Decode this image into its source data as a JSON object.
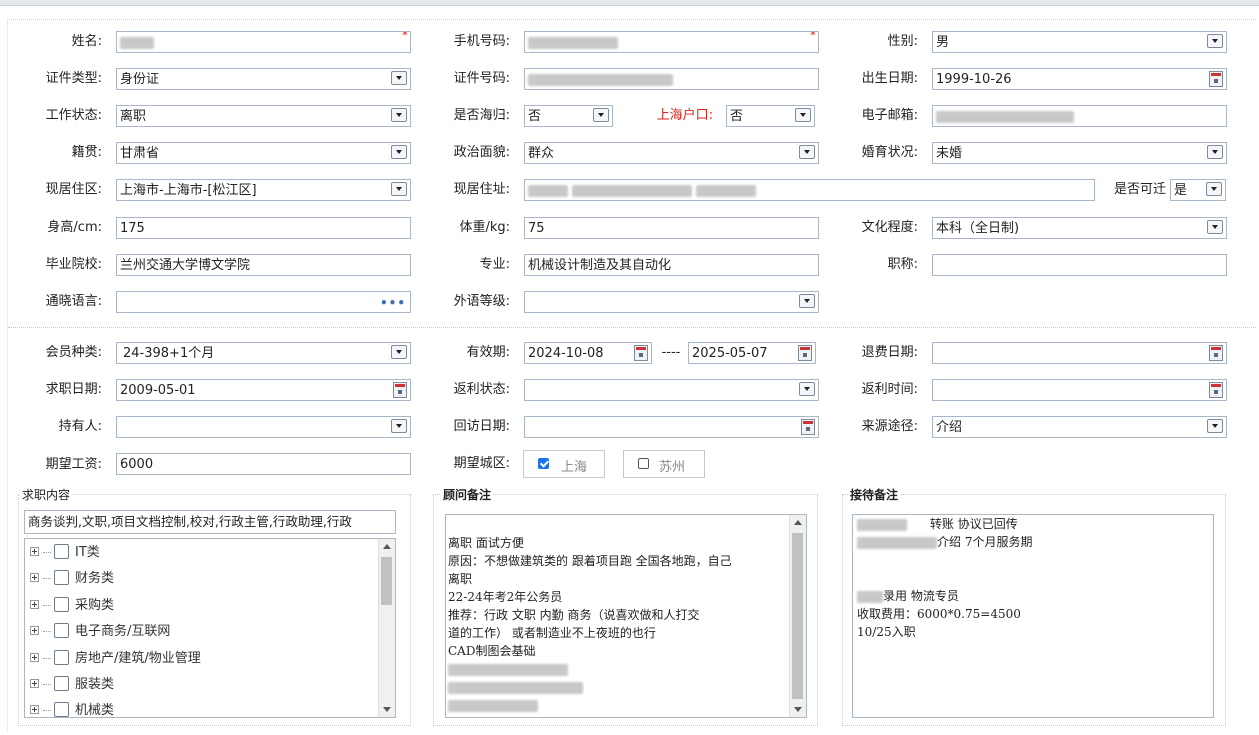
{
  "form": {
    "name_label": "姓名:",
    "name_value": "",
    "phone_label": "手机号码:",
    "phone_value": "",
    "gender_label": "性别:",
    "gender_value": "男",
    "id_type_label": "证件类型:",
    "id_type_value": "身份证",
    "id_no_label": "证件号码:",
    "id_no_value": "",
    "birth_label": "出生日期:",
    "birth_value": "1999-10-26",
    "work_status_label": "工作状态:",
    "work_status_value": "离职",
    "returnee_label": "是否海归:",
    "returnee_value": "否",
    "sh_hukou_label": "上海户口:",
    "sh_hukou_value": "否",
    "email_label": "电子邮箱:",
    "email_value": "",
    "native_label": "籍贯:",
    "native_value": "甘肃省",
    "political_label": "政治面貌:",
    "political_value": "群众",
    "marital_label": "婚育状况:",
    "marital_value": "未婚",
    "residence_label": "现居住区:",
    "residence_value": "上海市-上海市-[松江区]",
    "address_label": "现居住址:",
    "address_value": "",
    "relocate_label": "是否可迁",
    "relocate_value": "是",
    "height_label": "身高/cm:",
    "height_value": "175",
    "weight_label": "体重/kg:",
    "weight_value": "75",
    "education_label": "文化程度:",
    "education_value": "本科（全日制)",
    "school_label": "毕业院校:",
    "school_value": "兰州交通大学博文学院",
    "major_label": "专业:",
    "major_value": "机械设计制造及其自动化",
    "title_label": "职称:",
    "title_value": "",
    "language_label": "通晓语言:",
    "language_value": "",
    "foreign_level_label": "外语等级:",
    "foreign_level_value": "",
    "member_type_label": "会员种类:",
    "member_type_value": "24-398+1个月",
    "valid_label": "有效期:",
    "valid_from": "2024-10-08",
    "valid_sep": "----",
    "valid_to": "2025-05-07",
    "refund_date_label": "退费日期:",
    "refund_date_value": "",
    "job_date_label": "求职日期:",
    "job_date_value": "2009-05-01",
    "rebate_status_label": "返利状态:",
    "rebate_status_value": "",
    "rebate_time_label": "返利时间:",
    "rebate_time_value": "",
    "holder_label": "持有人:",
    "holder_value": "",
    "visit_date_label": "回访日期:",
    "visit_date_value": "",
    "source_label": "来源途径:",
    "source_value": "介绍",
    "salary_label": "期望工资:",
    "salary_value": "6000",
    "city_label": "期望城区:",
    "city_shanghai": "上海",
    "city_suzhou": "苏州"
  },
  "job_panel": {
    "title": "求职内容",
    "summary": "商务谈判,文职,项目文档控制,校对,行政主管,行政助理,行政",
    "categories": [
      "IT类",
      "财务类",
      "采购类",
      "电子商务/互联网",
      "房地产/建筑/物业管理",
      "服装类",
      "机械类"
    ]
  },
  "advisor_panel": {
    "title": "顾问备注",
    "lines": [
      "离职   面试方便",
      "原因：不想做建筑类的 跟着项目跑 全国各地跑，自己",
      "离职",
      "22-24年考2年公务员",
      "推荐：行政  文职   内勤  商务（说喜欢做和人打交",
      "道的工作）  或者制造业不上夜班的也行",
      "CAD制图会基础"
    ]
  },
  "reception_panel": {
    "title": "接待备注",
    "line1": "转账   协议已回传",
    "line2": "介绍   7个月服务期",
    "line3": "录用 物流专员",
    "line4": "收取费用：6000*0.75=4500",
    "line5": "10/25入职"
  }
}
